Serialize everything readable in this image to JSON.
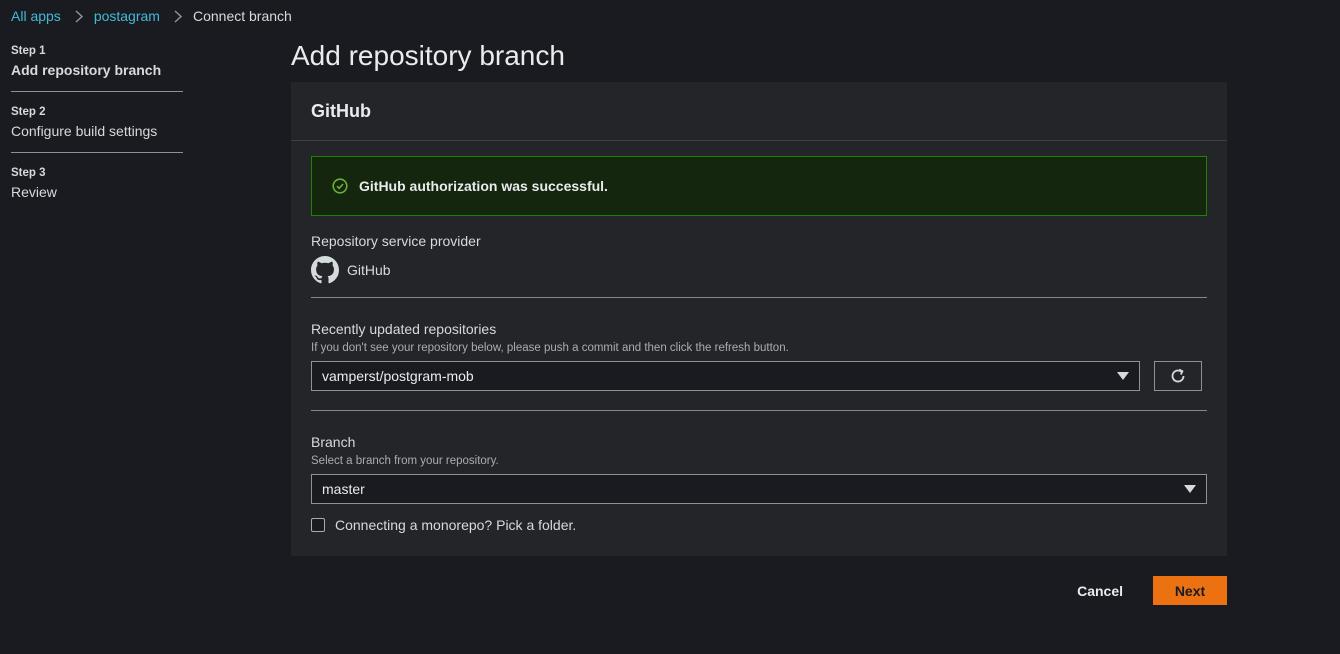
{
  "breadcrumb": {
    "items": [
      "All apps",
      "postagram"
    ],
    "current": "Connect branch"
  },
  "steps": [
    {
      "num": "Step 1",
      "name": "Add repository branch",
      "active": true
    },
    {
      "num": "Step 2",
      "name": "Configure build settings",
      "active": false
    },
    {
      "num": "Step 3",
      "name": "Review",
      "active": false
    }
  ],
  "page_title": "Add repository branch",
  "panel": {
    "header": "GitHub",
    "alert": "GitHub authorization was successful.",
    "provider": {
      "label": "Repository service provider",
      "name": "GitHub"
    },
    "repos": {
      "label": "Recently updated repositories",
      "desc": "If you don't see your repository below, please push a commit and then click the refresh button.",
      "selected": "vamperst/postgram-mob"
    },
    "branch": {
      "label": "Branch",
      "desc": "Select a branch from your repository.",
      "selected": "master"
    },
    "monorepo": {
      "label": "Connecting a monorepo? Pick a folder.",
      "checked": false
    }
  },
  "actions": {
    "cancel": "Cancel",
    "next": "Next"
  },
  "colors": {
    "accent": "#ec7211",
    "link": "#44b9d6",
    "success": "#1d8102"
  }
}
